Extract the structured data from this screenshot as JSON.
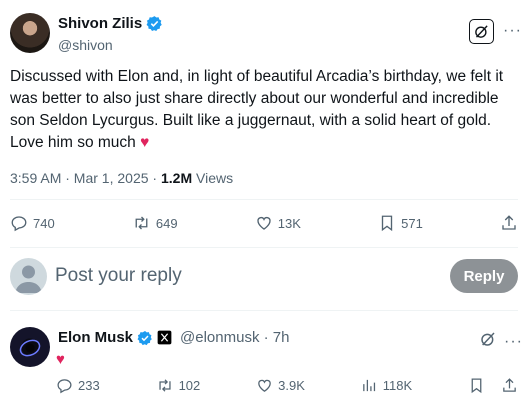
{
  "tweet": {
    "author_name": "Shivon Zilis",
    "handle": "@shivon",
    "text": "Discussed with Elon and, in light of beautiful Arcadia’s birthday, we felt it was better to also just share directly about our wonderful and incredible son Seldon Lycurgus. Built like a juggernaut, with a solid heart of gold. Love him so much",
    "text_emoji": "♥",
    "timestamp": "3:59 AM · Mar 1, 2025",
    "separator": " · ",
    "views_count": "1.2M",
    "views_label": " Views",
    "stats": {
      "replies": "740",
      "reposts": "649",
      "likes": "13K",
      "bookmarks": "571"
    },
    "more_label": "···"
  },
  "reply_box": {
    "placeholder": "Post your reply",
    "button_label": "Reply"
  },
  "reply": {
    "author_name": "Elon Musk",
    "handle_time": "@elonmusk · 7h",
    "text": "♥",
    "more_label": "···",
    "stats": {
      "replies": "233",
      "reposts": "102",
      "likes": "3.9K",
      "views": "118K"
    }
  },
  "colors": {
    "verified": "#1d9bf0",
    "heart": "#e0245e",
    "reply_button": "#8d9296",
    "muted": "#536471"
  },
  "icons": [
    "verified-badge-icon",
    "grok-icon",
    "more-icon",
    "reply-icon",
    "repost-icon",
    "like-icon",
    "bookmark-icon",
    "share-icon",
    "views-icon",
    "x-affiliate-icon"
  ]
}
